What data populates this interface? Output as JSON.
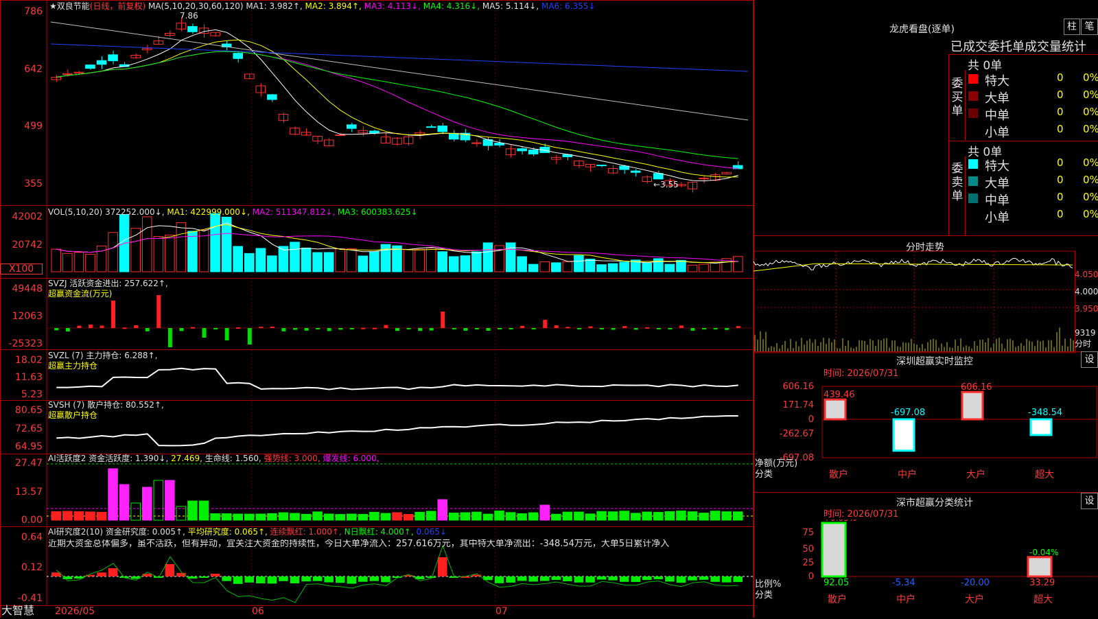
{
  "stock": {
    "name": "★双良节能",
    "mode": "(日线，前复权)"
  },
  "main": {
    "ma_title": "MA(5,10,20,30,60,120)",
    "ma1": "MA1: 3.982↑,",
    "ma2": "MA2: 3.894↑,",
    "ma3": "MA3: 4.113↓,",
    "ma4": "MA4: 4.316↓,",
    "ma5": "MA5: 5.114↓,",
    "ma6": "MA6: 6.355↓",
    "yticks": [
      "786",
      "642",
      "499",
      "355"
    ],
    "high_label": "7.86",
    "low_label": "←3.55"
  },
  "vol": {
    "title": "VOL(5,10,20)",
    "value": "372252.000↓,",
    "ma1": "MA1: 422999.000↓,",
    "ma2": "MA2: 511347.812↓,",
    "ma3": "MA3: 600383.625↓",
    "yticks": [
      "42002",
      "20742"
    ],
    "unit": "X100"
  },
  "svzj": {
    "title": "SVZJ  活跃资金进出: 257.622↑,",
    "subtitle": "超赢资金流(万元)",
    "yticks": [
      "49448",
      "12063",
      "-25323"
    ]
  },
  "svzl": {
    "title": "SVZL  (7) 主力持仓: 6.288↑,",
    "subtitle": "超赢主力持仓",
    "yticks": [
      "18.02",
      "11.63",
      "5.23"
    ]
  },
  "svsh": {
    "title": "SVSH  (7) 散户持仓: 80.552↑,",
    "subtitle": "超赢散户持仓",
    "yticks": [
      "80.65",
      "72.65",
      "64.95"
    ]
  },
  "ai1": {
    "title": "AI活跃度2 资金活跃度: 1.390↓,",
    "v2": "27.469,",
    "v3": "生命线: 1.560,",
    "v4": "强势线: 3.000,",
    "v5": "爆发线: 6.000,",
    "yticks": [
      "27.47",
      "13.57",
      "0.00"
    ]
  },
  "ai2": {
    "title": "AI研究度2(10) 资金研究度: 0.005↑,",
    "v2": "平均研究度: 0.065↑,",
    "v3": "连续飘红: 1.000↑,",
    "v4": "N日飘红: 4.000↑,",
    "v5": "0.065↓",
    "text": "近期大资金总体偏多，虽不活跃，但有异动，宜关注大资金的持续性，今日大单净流入：257.616万元，其中特大单净流出：-348.54万元，大单5日累计净入",
    "yticks": [
      "0.64",
      "0.12",
      "-0.41"
    ]
  },
  "xaxis": {
    "app": "大智慧",
    "labels": [
      "2026/05",
      "06",
      "07"
    ]
  },
  "longhu": {
    "title": "龙虎看盘(逐单)",
    "btn1": "柱",
    "btn2": "笔",
    "sub": "已成交委托单成交量统计",
    "buy_side": "委买单",
    "sell_side": "委卖单",
    "buy_total": "共 0单",
    "sell_total": "共 0单",
    "buy_rows": [
      {
        "label": "特大",
        "n": "0",
        "p": "0%",
        "color": "#ff0000"
      },
      {
        "label": "大单",
        "n": "0",
        "p": "0%",
        "color": "#8b0000"
      },
      {
        "label": "中单",
        "n": "0",
        "p": "0%",
        "color": "#6b0000"
      },
      {
        "label": "小单",
        "n": "0",
        "p": "0%",
        "color": "#000000"
      }
    ],
    "sell_rows": [
      {
        "label": "特大",
        "n": "0",
        "p": "0%",
        "color": "#00ffff"
      },
      {
        "label": "大单",
        "n": "0",
        "p": "0%",
        "color": "#008b8b"
      },
      {
        "label": "中单",
        "n": "0",
        "p": "0%",
        "color": "#007070"
      },
      {
        "label": "小单",
        "n": "0",
        "p": "0%",
        "color": "#000000"
      }
    ]
  },
  "fenshi": {
    "title": "分时走势",
    "yticks": [
      "4.050",
      "4.000",
      "3.950"
    ],
    "vol": "9319",
    "vol_unit": "分时"
  },
  "monitor": {
    "title": "深圳超赢实时监控",
    "settings": "设",
    "time": "时间: 2026/07/31",
    "yticks": [
      "606.16",
      "171.74",
      "0",
      "-262.67",
      "-697.08"
    ],
    "ylabel": "净额(万元)",
    "xlabel": "分类",
    "cats": [
      "散户",
      "中户",
      "大户",
      "超大"
    ],
    "values": [
      439.46,
      -697.08,
      606.16,
      -348.54
    ],
    "value_labels": [
      "439.46",
      "-697.08",
      "606.16",
      "-348.54"
    ]
  },
  "classify": {
    "title": "深市超赢分类统计",
    "settings": "设",
    "time": "时间: 2026/07/31",
    "yticks": [
      "75",
      "50",
      "25",
      "0"
    ],
    "ylabel": "比例%",
    "xlabel": "分类",
    "cats": [
      "散户",
      "中户",
      "大户",
      "超大"
    ],
    "values": [
      92.05,
      -5.34,
      -20.0,
      33.29
    ],
    "value_labels": [
      "92.05",
      "-5.34",
      "-20.00",
      "33.29"
    ],
    "top_labels": [
      "+0.05%",
      "-0.04%"
    ]
  }
}
